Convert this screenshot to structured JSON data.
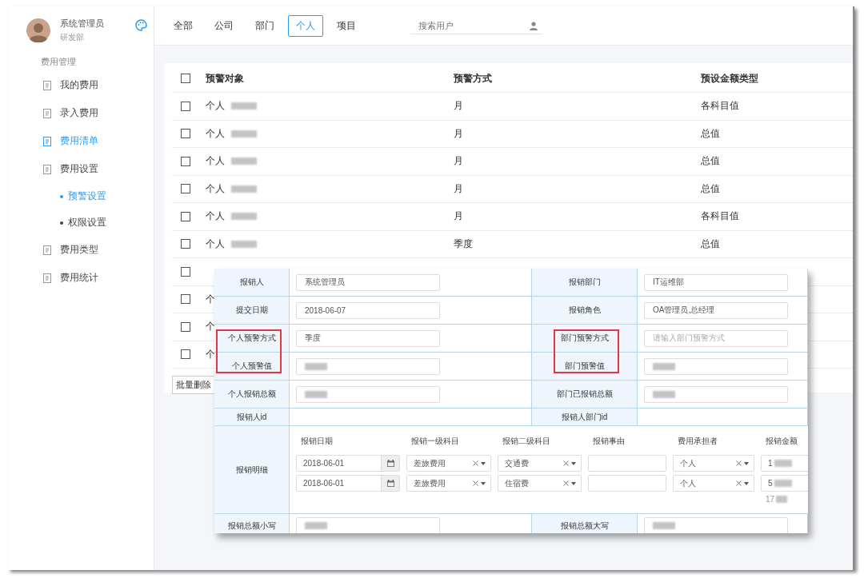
{
  "sidebar": {
    "user": {
      "name": "系统管理员",
      "department": "研发部"
    },
    "section_title": "费用管理",
    "items": [
      {
        "label": "我的费用",
        "selected": false
      },
      {
        "label": "录入费用",
        "selected": false
      },
      {
        "label": "费用清单",
        "selected": true
      },
      {
        "label": "费用设置",
        "selected": false,
        "children": [
          {
            "label": "预警设置",
            "selected": true
          },
          {
            "label": "权限设置",
            "selected": false
          }
        ]
      },
      {
        "label": "费用类型",
        "selected": false
      },
      {
        "label": "费用统计",
        "selected": false
      }
    ]
  },
  "topbar": {
    "tabs": [
      {
        "label": "全部",
        "selected": false
      },
      {
        "label": "公司",
        "selected": false
      },
      {
        "label": "部门",
        "selected": false
      },
      {
        "label": "个人",
        "selected": true
      },
      {
        "label": "项目",
        "selected": false
      }
    ],
    "search": {
      "placeholder": "搜索用户"
    }
  },
  "table": {
    "header_checked": false,
    "columns": [
      "预警对象",
      "预警方式",
      "预设金额类型"
    ],
    "rows": [
      {
        "checked": false,
        "target": "个人",
        "redacted": true,
        "method": "月",
        "amount_type": "各科目值"
      },
      {
        "checked": false,
        "target": "个人",
        "redacted": true,
        "method": "月",
        "amount_type": "总值"
      },
      {
        "checked": false,
        "target": "个人",
        "redacted": true,
        "method": "月",
        "amount_type": "总值"
      },
      {
        "checked": false,
        "target": "个人",
        "redacted": true,
        "method": "月",
        "amount_type": "总值"
      },
      {
        "checked": false,
        "target": "个人",
        "redacted": true,
        "method": "月",
        "amount_type": "各科目值"
      },
      {
        "checked": false,
        "target": "个人",
        "redacted": true,
        "method": "季度",
        "amount_type": "总值"
      },
      {
        "checked": false
      },
      {
        "checked": false,
        "target": "个"
      },
      {
        "checked": false,
        "target": "个"
      },
      {
        "checked": false,
        "target": "个"
      }
    ]
  },
  "batch_delete": "批量删除",
  "form": {
    "rows": [
      {
        "kind": "pair",
        "cells": [
          {
            "label": "报销人",
            "highlighted": false,
            "field": {
              "value": "系统管理员"
            }
          },
          {
            "label": "报销部门",
            "highlighted": false,
            "field": {
              "value": "IT运维部"
            }
          }
        ]
      },
      {
        "kind": "pair",
        "cells": [
          {
            "label": "提交日期",
            "highlighted": false,
            "field": {
              "value": "2018-06-07"
            }
          },
          {
            "label": "报销角色",
            "highlighted": false,
            "field": {
              "value": "OA管理员,总经理"
            }
          }
        ]
      },
      {
        "kind": "pair",
        "cells": [
          {
            "label": "个人预警方式",
            "highlighted": true,
            "field": {
              "value": "季度"
            }
          },
          {
            "label": "部门预警方式",
            "highlighted": true,
            "field": {
              "placeholder": "请输入部门预警方式"
            }
          }
        ]
      },
      {
        "kind": "pair",
        "cells": [
          {
            "label": "个人预警值",
            "highlighted": true,
            "field": {
              "redacted": true
            }
          },
          {
            "label": "部门预警值",
            "highlighted": true,
            "field": {
              "redacted": true
            }
          }
        ]
      },
      {
        "kind": "pair",
        "cells": [
          {
            "label": "个人报销总额",
            "highlighted": false,
            "field": {
              "redacted": true
            }
          },
          {
            "label": "部门已报销总额",
            "highlighted": false,
            "field": {
              "redacted": true
            }
          }
        ]
      },
      {
        "kind": "pair",
        "cells": [
          {
            "label": "报销人id",
            "highlighted": false
          },
          {
            "label": "报销人部门id",
            "highlighted": false
          }
        ]
      },
      {
        "kind": "detail",
        "label": "报销明细",
        "columns": [
          "报销日期",
          "报销一级科目",
          "报销二级科目",
          "报销事由",
          "费用承担者",
          "报销金额"
        ],
        "lines": [
          {
            "cells": [
              {
                "kind": "date",
                "value": "2018-06-01"
              },
              {
                "kind": "select",
                "value": "差旅费用"
              },
              {
                "kind": "select",
                "value": "交通费"
              },
              {
                "kind": "input"
              },
              {
                "kind": "select",
                "value": "个人"
              },
              {
                "kind": "amount",
                "value": "1",
                "redacted": true
              }
            ]
          },
          {
            "cells": [
              {
                "kind": "date",
                "value": "2018-06-01"
              },
              {
                "kind": "select",
                "value": "差旅费用"
              },
              {
                "kind": "select",
                "value": "住宿费"
              },
              {
                "kind": "input"
              },
              {
                "kind": "select",
                "value": "个人"
              },
              {
                "kind": "amount",
                "value": "5",
                "redacted": true
              }
            ]
          }
        ],
        "total": {
          "value": "17",
          "redacted": true
        }
      },
      {
        "kind": "pair",
        "cells": [
          {
            "label": "报销总额小写",
            "highlighted": false,
            "field": {
              "redacted": true
            }
          },
          {
            "label": "报销总额大写",
            "highlighted": false,
            "field": {
              "redacted": true
            }
          }
        ]
      }
    ]
  }
}
